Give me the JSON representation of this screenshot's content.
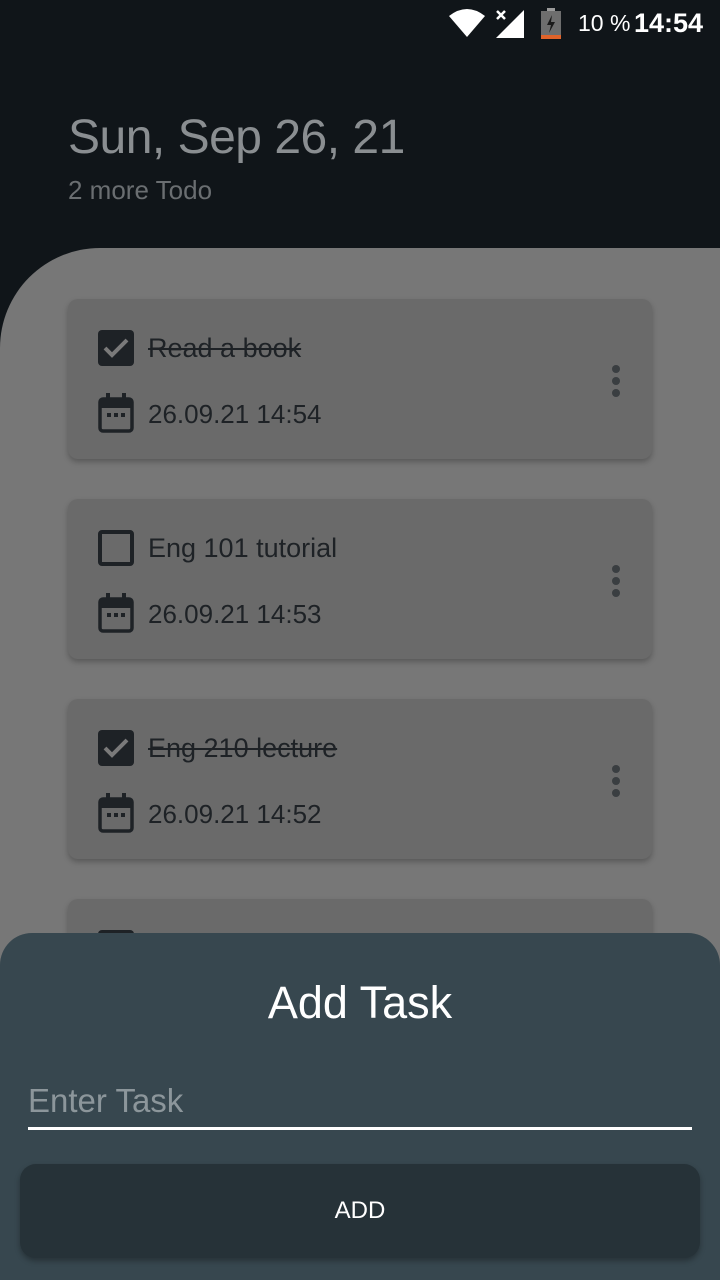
{
  "status_bar": {
    "battery_percent": "10 %",
    "time": "14:54",
    "icons": [
      "wifi-icon",
      "signal-icon",
      "battery-icon"
    ]
  },
  "header": {
    "date": "Sun, Sep 26, 21",
    "subtitle": "2 more Todo"
  },
  "tasks": [
    {
      "title": "Read a book",
      "datetime": "26.09.21 14:54",
      "done": true
    },
    {
      "title": "Eng 101 tutorial",
      "datetime": "26.09.21 14:53",
      "done": false
    },
    {
      "title": "Eng 210 lecture",
      "datetime": "26.09.21 14:52",
      "done": true
    }
  ],
  "sheet": {
    "title": "Add Task",
    "input_placeholder": "Enter Task",
    "input_value": "",
    "add_label": "ADD"
  },
  "colors": {
    "header_bg": "#101519",
    "content_bg": "#777777",
    "card_bg": "#6a6a6a",
    "sheet_bg": "#37474f",
    "button_bg": "#263238"
  }
}
